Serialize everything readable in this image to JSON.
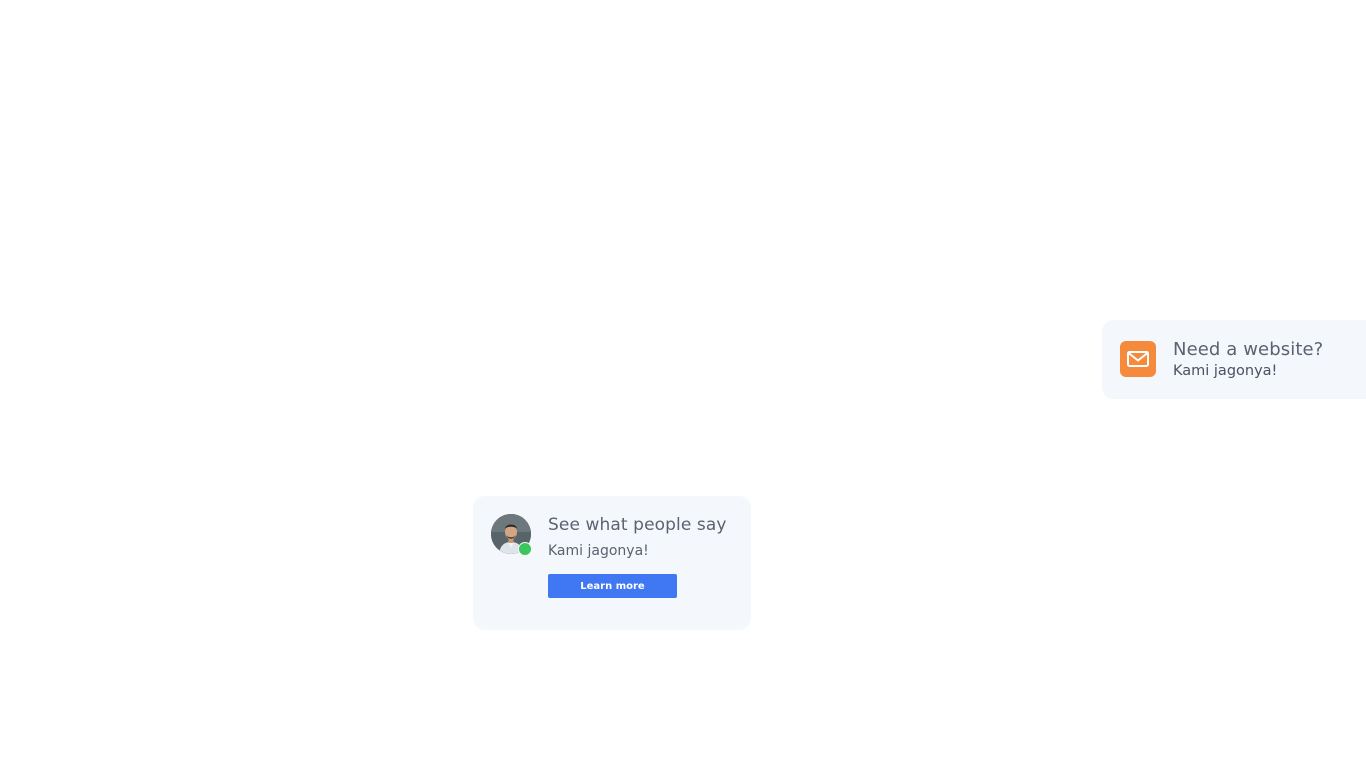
{
  "website_notice": {
    "title": "Need a website?",
    "subtitle": "Kami jagonya!",
    "icon": "mail-icon",
    "icon_color": "#f58a3c"
  },
  "testimonial": {
    "title": "See what people say",
    "subtitle": "Kami jagonya!",
    "button_label": "Learn more",
    "button_color": "#3f78f2",
    "avatar": "user-avatar",
    "status_icon": "online-status-dot",
    "status_color": "#3bc55c"
  }
}
